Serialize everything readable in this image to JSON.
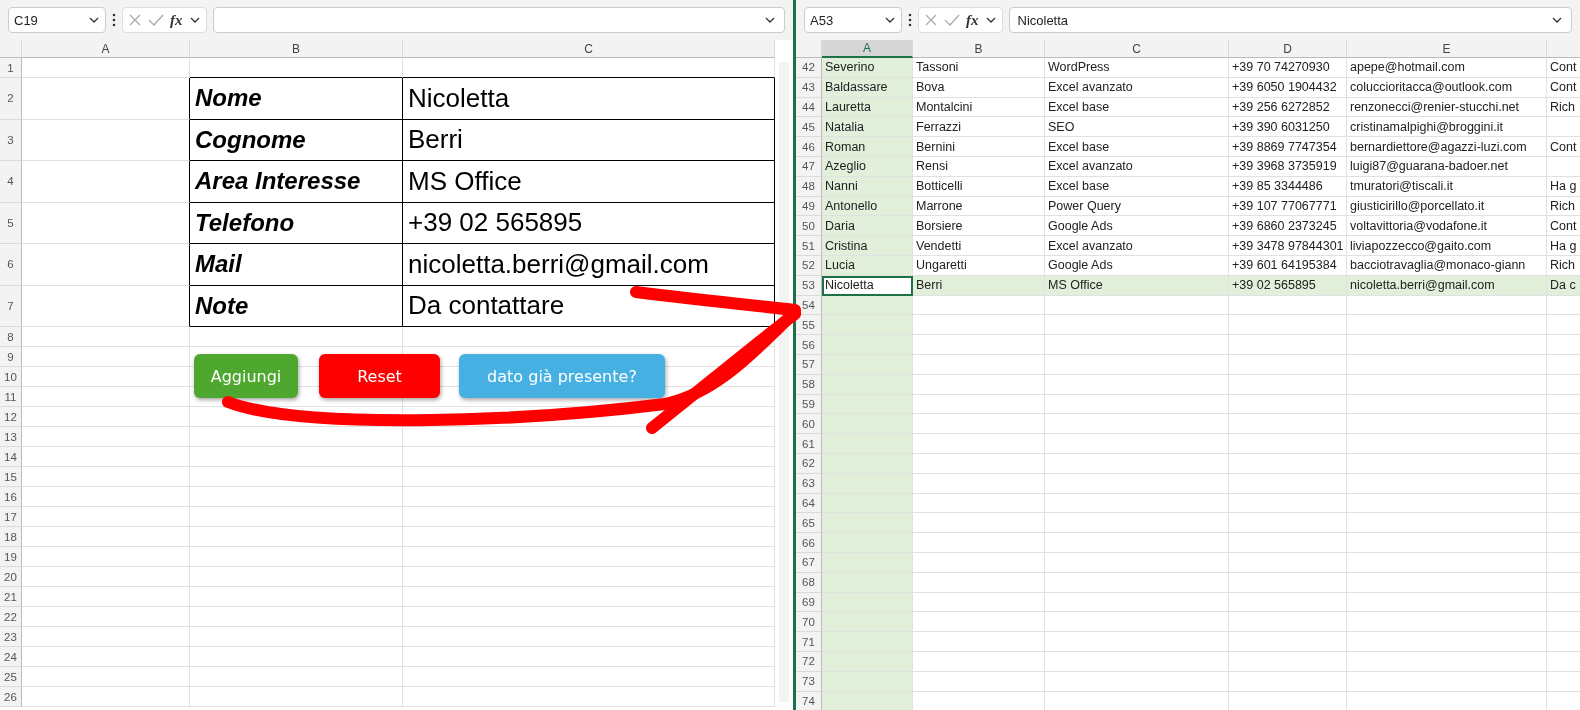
{
  "left_pane": {
    "name_box": "C19",
    "function_label": "fx",
    "columns": [
      "A",
      "B",
      "C"
    ],
    "rows": [
      {
        "number": "1"
      },
      {
        "number": "2",
        "label": "Nome",
        "value": "Nicoletta"
      },
      {
        "number": "3",
        "label": "Cognome",
        "value": "Berri"
      },
      {
        "number": "4",
        "label": "Area Interesse",
        "value": "MS Office"
      },
      {
        "number": "5",
        "label": "Telefono",
        "value": "+39 02 565895"
      },
      {
        "number": "6",
        "label": "Mail",
        "value": "nicoletta.berri@gmail.com"
      },
      {
        "number": "7",
        "label": "Note",
        "value": "Da contattare"
      },
      {
        "number": "8"
      },
      {
        "number": "9"
      },
      {
        "number": "10"
      },
      {
        "number": "11"
      },
      {
        "number": "12"
      },
      {
        "number": "13"
      },
      {
        "number": "14"
      },
      {
        "number": "15"
      },
      {
        "number": "16"
      },
      {
        "number": "17"
      },
      {
        "number": "18"
      },
      {
        "number": "19"
      },
      {
        "number": "20"
      },
      {
        "number": "21"
      },
      {
        "number": "22"
      },
      {
        "number": "23"
      },
      {
        "number": "24"
      },
      {
        "number": "25"
      },
      {
        "number": "26"
      }
    ],
    "buttons": [
      {
        "label": "Aggiungi",
        "color": "#4ea72e"
      },
      {
        "label": "Reset",
        "color": "#ff0000"
      },
      {
        "label": "dato già presente?",
        "color": "#45b0e1"
      }
    ]
  },
  "right_pane": {
    "name_box": "A53",
    "function_label": "fx",
    "formula": "Nicoletta",
    "columns": [
      {
        "label": "A",
        "selected": true
      },
      {
        "label": "B",
        "selected": false
      },
      {
        "label": "C",
        "selected": false
      },
      {
        "label": "D",
        "selected": false
      },
      {
        "label": "E",
        "selected": false
      }
    ],
    "rows": [
      {
        "number": "42",
        "selected": false,
        "cells": [
          "Severino",
          "Tassoni",
          "WordPress",
          "+39 70 74270930",
          "apepe@hotmail.com",
          "Cont"
        ]
      },
      {
        "number": "43",
        "selected": false,
        "cells": [
          "Baldassare",
          "Bova",
          "Excel avanzato",
          "+39 6050 1904432",
          "coluccioritacca@outlook.com",
          "Cont"
        ]
      },
      {
        "number": "44",
        "selected": false,
        "cells": [
          "Lauretta",
          "Montalcini",
          "Excel base",
          "+39 256 6272852",
          "renzonecci@renier-stucchi.net",
          "Rich"
        ]
      },
      {
        "number": "45",
        "selected": false,
        "cells": [
          "Natalia",
          "Ferrazzi",
          "SEO",
          "+39 390 6031250",
          "cristinamalpighi@broggini.it",
          null
        ]
      },
      {
        "number": "46",
        "selected": false,
        "cells": [
          "Roman",
          "Bernini",
          "Excel base",
          "+39 8869 7747354",
          "bernardiettore@agazzi-luzi.com",
          "Cont"
        ]
      },
      {
        "number": "47",
        "selected": false,
        "cells": [
          "Azeglio",
          "Rensi",
          "Excel avanzato",
          "+39 3968 3735919",
          "luigi87@guarana-badoer.net",
          null
        ]
      },
      {
        "number": "48",
        "selected": false,
        "cells": [
          "Nanni",
          "Botticelli",
          "Excel base",
          "+39 85 3344486",
          "tmuratori@tiscali.it",
          "Ha g"
        ]
      },
      {
        "number": "49",
        "selected": false,
        "cells": [
          "Antonello",
          "Marrone",
          "Power Query",
          "+39 107 77067771",
          "giusticirillo@porcellato.it",
          "Rich"
        ]
      },
      {
        "number": "50",
        "selected": false,
        "cells": [
          "Daria",
          "Borsiere",
          "Google Ads",
          "+39 6860 2373245",
          "voltavittoria@vodafone.it",
          "Cont"
        ]
      },
      {
        "number": "51",
        "selected": false,
        "cells": [
          "Cristina",
          "Vendetti",
          "Excel avanzato",
          "+39 3478 97844301",
          "liviapozzecco@gaito.com",
          "Ha g"
        ]
      },
      {
        "number": "52",
        "selected": false,
        "cells": [
          "Lucia",
          "Ungaretti",
          "Google Ads",
          "+39 601 64195384",
          "bacciotravaglia@monaco-giann",
          "Rich"
        ]
      },
      {
        "number": "53",
        "selected": true,
        "cells": [
          "Nicoletta",
          "Berri",
          "MS Office",
          "+39 02 565895",
          "nicoletta.berri@gmail.com",
          "Da c"
        ]
      },
      {
        "number": "54"
      },
      {
        "number": "55"
      },
      {
        "number": "56"
      },
      {
        "number": "57"
      },
      {
        "number": "58"
      },
      {
        "number": "59"
      },
      {
        "number": "60"
      },
      {
        "number": "61"
      },
      {
        "number": "62"
      },
      {
        "number": "63"
      },
      {
        "number": "64"
      },
      {
        "number": "65"
      },
      {
        "number": "66"
      },
      {
        "number": "67"
      },
      {
        "number": "68"
      },
      {
        "number": "69"
      },
      {
        "number": "70"
      },
      {
        "number": "71"
      },
      {
        "number": "72"
      },
      {
        "number": "73"
      },
      {
        "number": "74"
      }
    ]
  }
}
